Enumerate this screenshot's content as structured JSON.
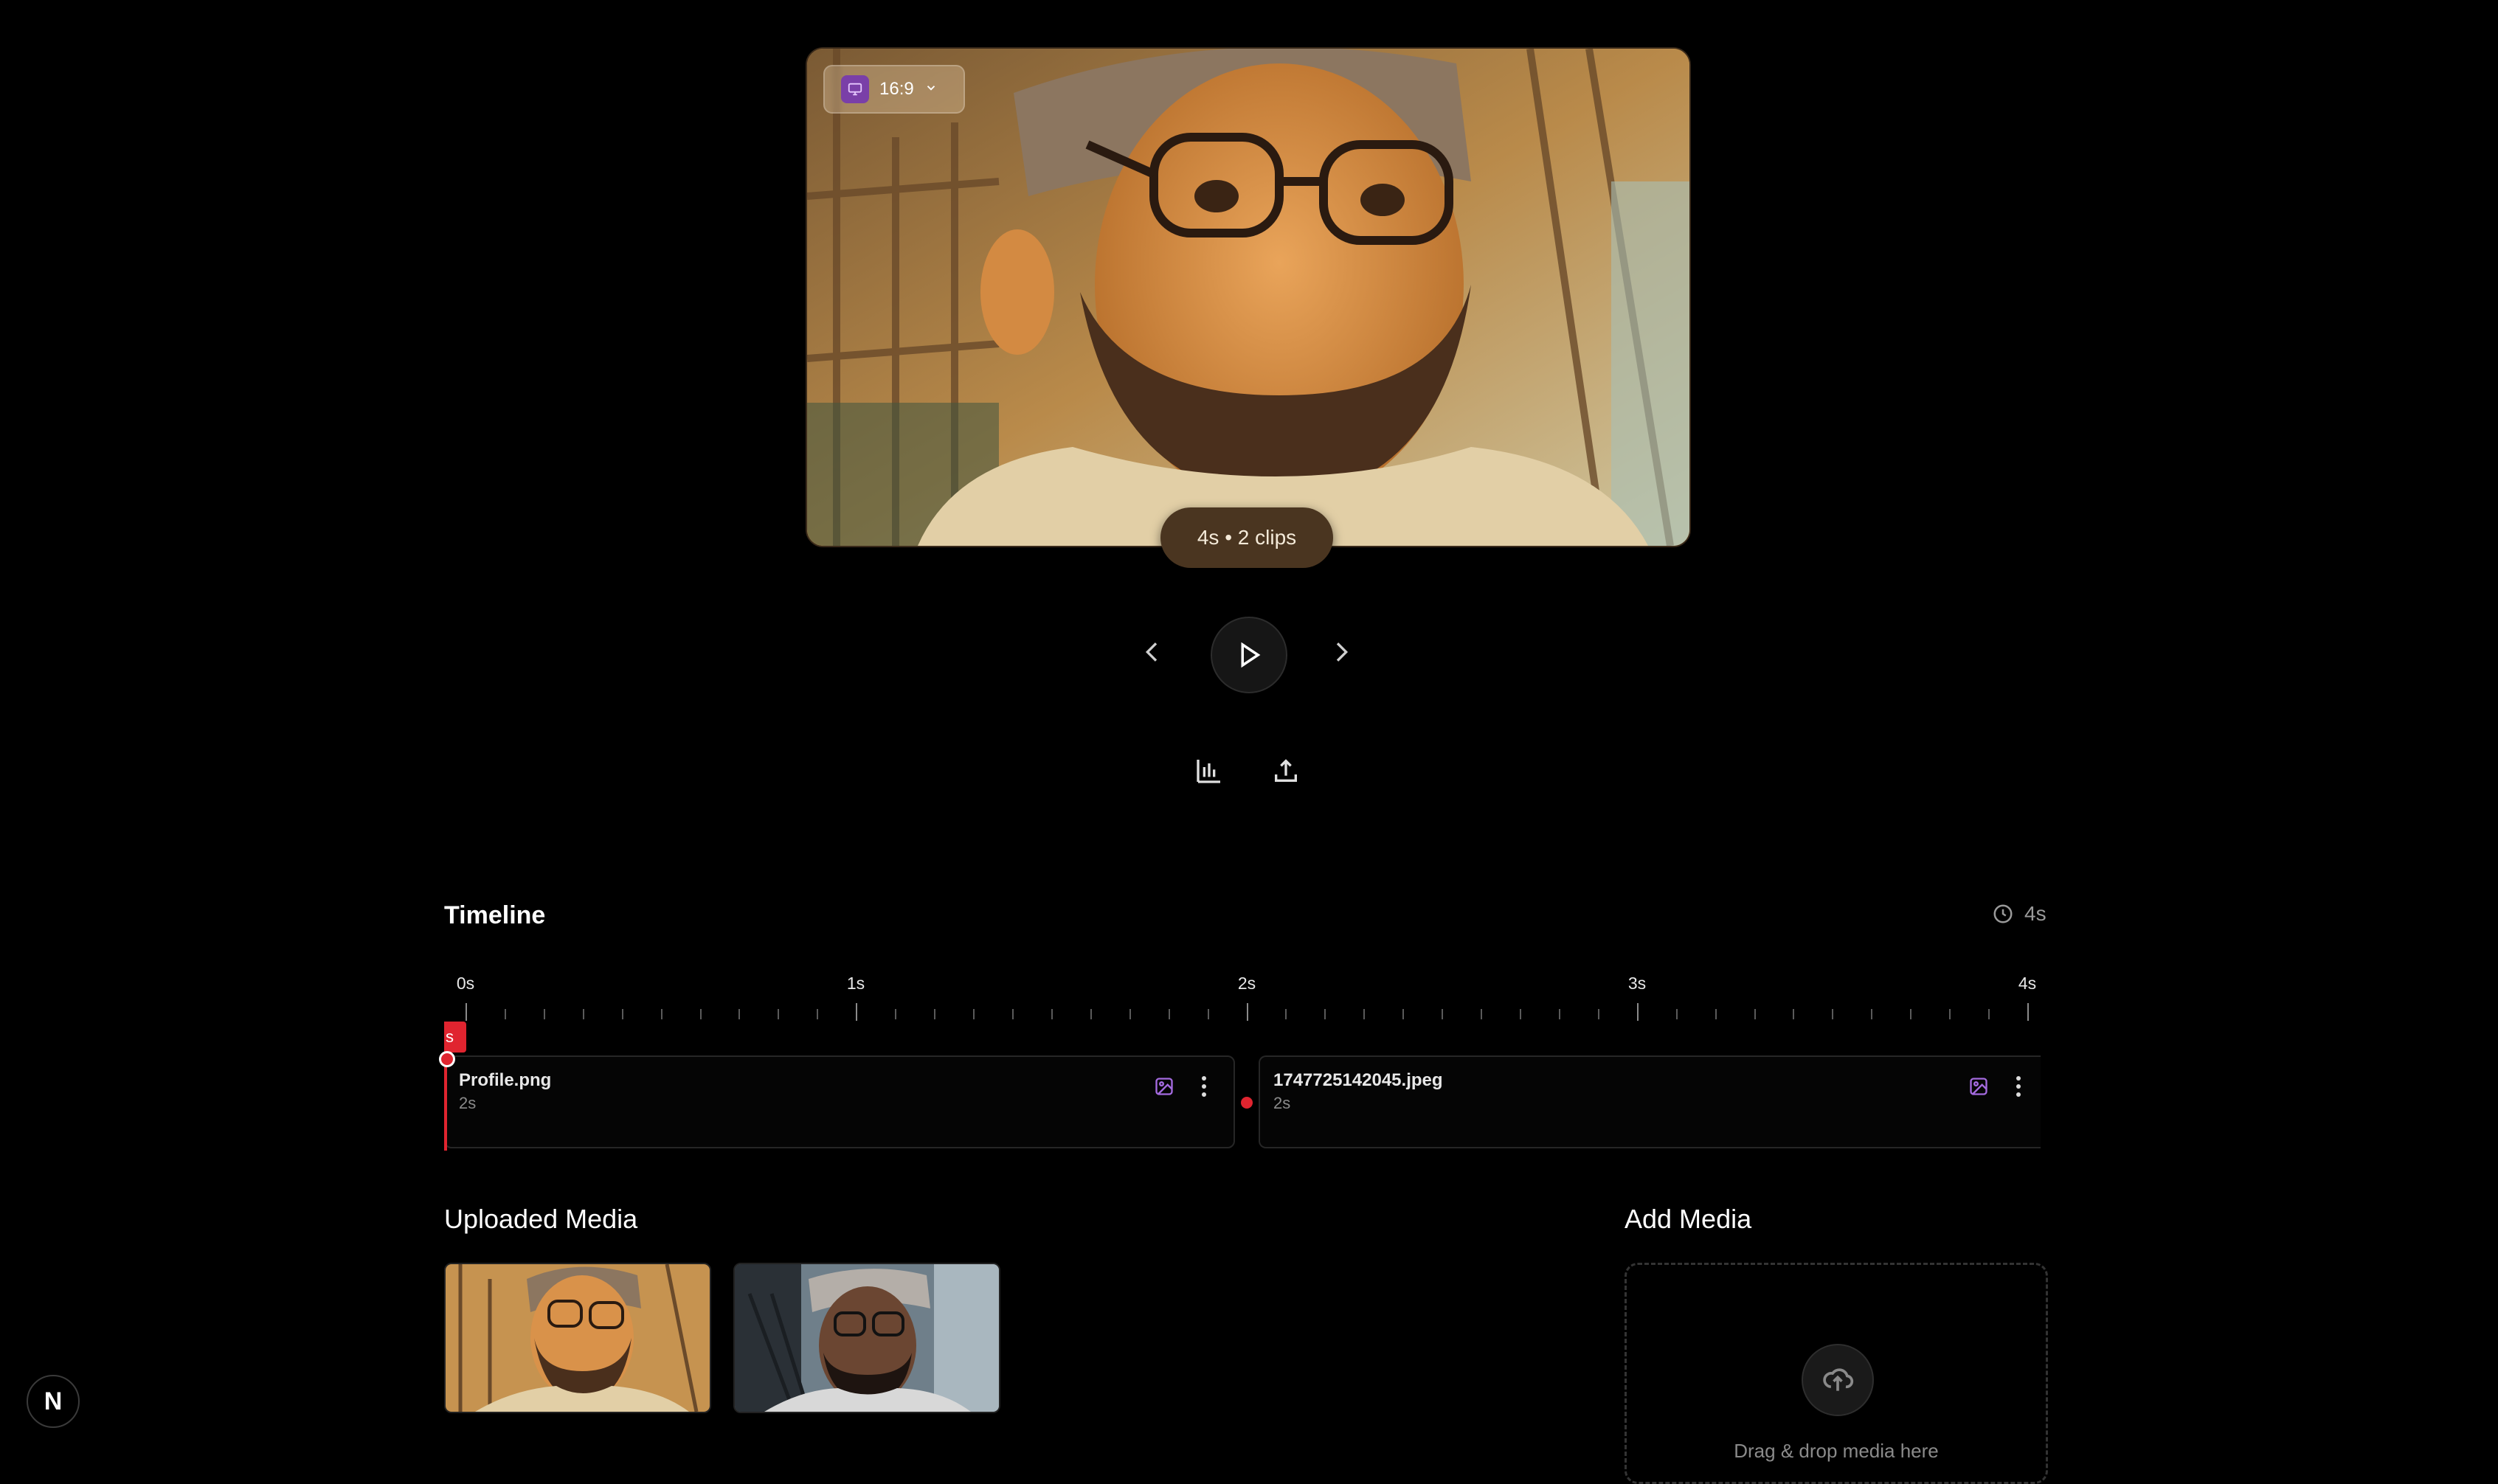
{
  "preview": {
    "aspect_ratio": "16:9",
    "clip_summary": "4s • 2 clips"
  },
  "timeline": {
    "title": "Timeline",
    "total_duration": "4s",
    "ticks": [
      "0s",
      "1s",
      "2s",
      "3s",
      "4s"
    ],
    "playhead_label": "s",
    "clips": [
      {
        "name": "Profile.png",
        "duration": "2s"
      },
      {
        "name": "1747725142045.jpeg",
        "duration": "2s"
      }
    ]
  },
  "uploaded_media": {
    "title": "Uploaded Media"
  },
  "add_media": {
    "title": "Add Media",
    "drop_text": "Drag & drop media here"
  },
  "badge": {
    "letter": "N"
  },
  "colors": {
    "accent": "#e0242f",
    "icon_purple": "#a56be0",
    "pill_bg": "#4a3520"
  }
}
